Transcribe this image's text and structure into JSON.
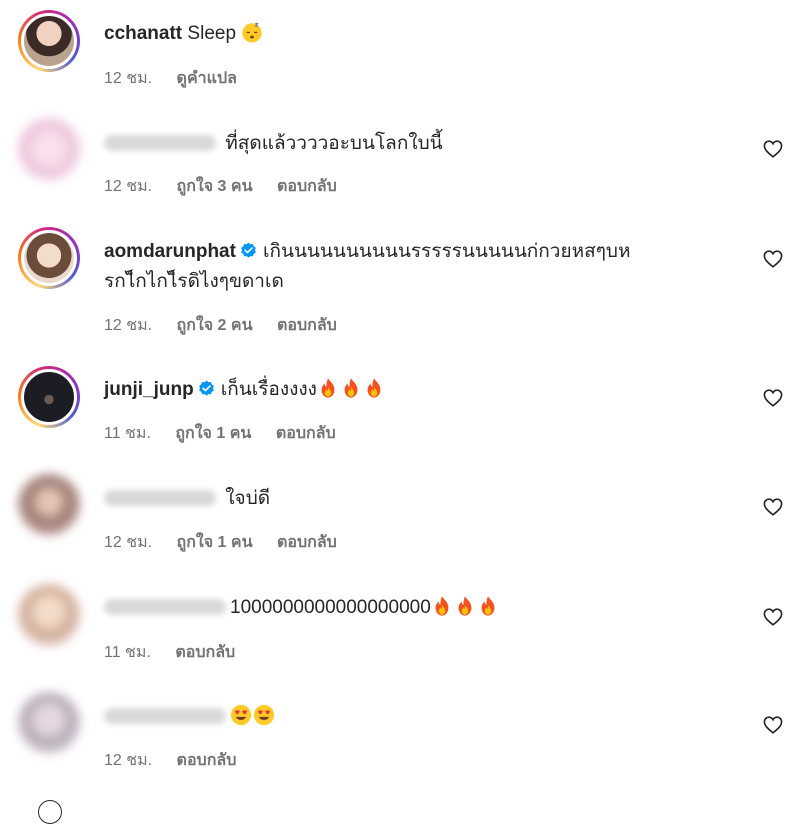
{
  "comments": [
    {
      "username": "cchanatt",
      "text": "Sleep",
      "time": "12 ชม.",
      "see_translation": "ดูคำแปล"
    },
    {
      "username": "hidden",
      "text": "ที่สุดแล้ววววอะบนโลกใบนี้",
      "time": "12 ชม.",
      "likes": "ถูกใจ 3 คน",
      "reply": "ตอบกลับ"
    },
    {
      "username": "aomdarunphat",
      "text_line1": "เกินนนนนนนนนนรรรรรนนนนนก่กวยหสๆบห",
      "text_line2": "รกไ็กไกไ็รดิไงๆขดาเด",
      "time": "12 ชม.",
      "likes": "ถูกใจ 2 คน",
      "reply": "ตอบกลับ"
    },
    {
      "username": "junji_junp",
      "text": "เก็นเรื่องงงง",
      "time": "11 ชม.",
      "likes": "ถูกใจ 1 คน",
      "reply": "ตอบกลับ"
    },
    {
      "username": "hidden",
      "text": "ใจบ่ดี",
      "time": "12 ชม.",
      "likes": "ถูกใจ 1 คน",
      "reply": "ตอบกลับ"
    },
    {
      "username": "hidden",
      "text": "1000000000000000000",
      "time": "11 ชม.",
      "reply": "ตอบกลับ"
    },
    {
      "username": "hidden",
      "text": "",
      "time": "12 ชม.",
      "reply": "ตอบกลับ"
    }
  ],
  "icons": {
    "heart": "heart-outline-icon",
    "verified": "verified-badge-icon",
    "fire": "fire-emoji",
    "heart_eyes": "heart-eyes-emoji",
    "sleeping": "sleeping-emoji"
  },
  "colors": {
    "verified": "#0095f6",
    "meta": "#737373",
    "text": "#262626"
  }
}
